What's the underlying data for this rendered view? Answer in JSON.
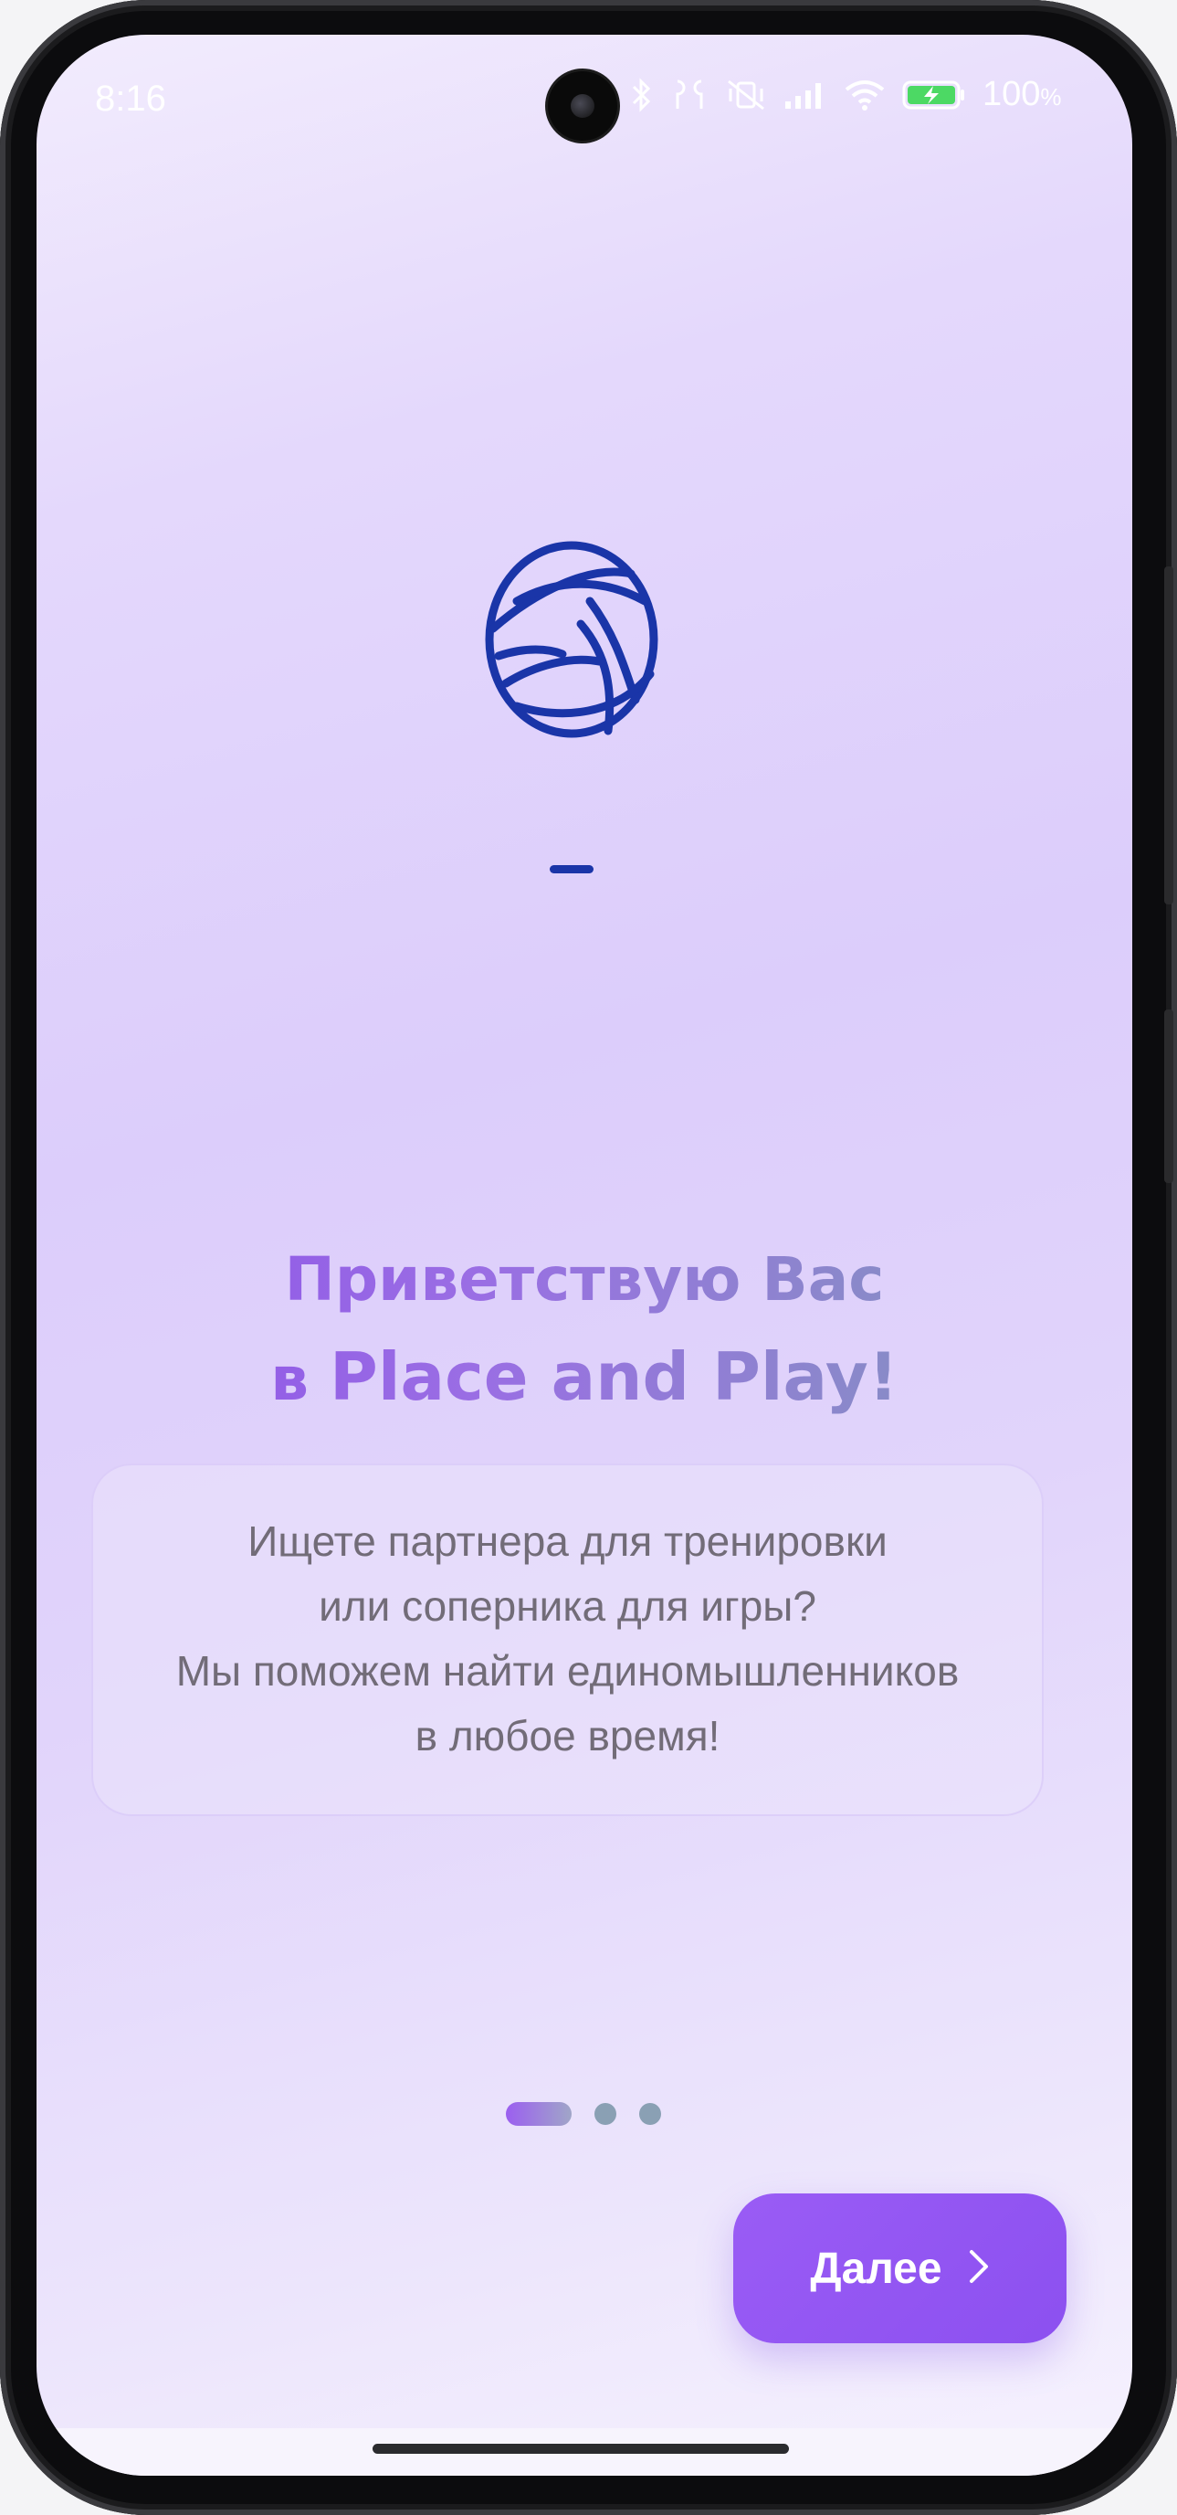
{
  "status_bar": {
    "time": "8:16",
    "battery_percent": "100",
    "battery_unit": "%",
    "icons": [
      "bluetooth-icon",
      "earbuds-icon",
      "vibrate-off-icon",
      "signal-icon",
      "wifi-icon",
      "battery-charging-icon"
    ]
  },
  "logo": {
    "icon": "volleyball-icon",
    "color": "#1a35a8"
  },
  "welcome": {
    "title_line1": "Приветствую Вас",
    "title_prefix": "в",
    "title_app": "Place and Play!"
  },
  "description": {
    "line1": "Ищете партнера для тренировки",
    "line2": "или соперника для игры?",
    "line3": "Мы поможем найти единомышленников",
    "line4": "в любое время!"
  },
  "pager": {
    "total": 3,
    "active": 1
  },
  "next_button": {
    "label": "Далее",
    "icon": "chevron-right-icon"
  },
  "colors": {
    "accent": "#9257f4",
    "logo": "#1a35a8",
    "text": "#726c78"
  }
}
